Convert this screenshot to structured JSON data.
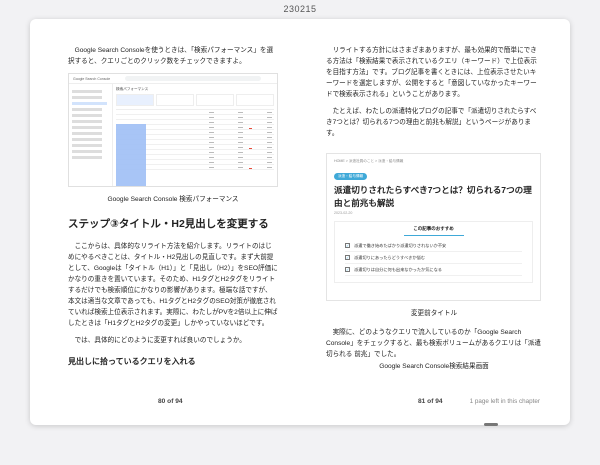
{
  "window": {
    "title": "230215"
  },
  "left_page": {
    "intro": "Google Search Consoleを使うときは、「検索パフォーマンス」を選択すると、クエリごとのクリック数をチェックできますよ。",
    "figure_caption": "Google Search Console 検索パフォーマンス",
    "heading": "ステップ③タイトル・H2見出しを変更する",
    "body": "ここからは、具体的なリライト方法を紹介します。リライトのはじめにやるべきことは、タイトル・H2見出しの見直しです。まず大前提として、Googleは「タイトル（H1）」と「見出し（H2）」をSEO評価にかなりの重きを置いています。そのため、H1タグとH2タグをリライトするだけでも検索順位にかなりの影響があります。極端な話ですが、本文は適当な文章であっても、H1タグとH2タグのSEO対策が徹底されていれば検索上位表示されます。実際に、わたしがPVを2倍以上に伸ばしたときは「H1タグとH2タグの変更」しかやっていないほどです。",
    "followup": "では、具体的にどのように変更すれば良いのでしょうか。",
    "subheading": "見出しに拾っているクエリを入れる",
    "page_number": "80 of 94"
  },
  "search_console": {
    "app": "Google Search Console",
    "panel": "検索パフォーマンス"
  },
  "right_page": {
    "para1": "リライトする方針にはさまざまありますが、最も効果的で簡単にできる方法は「検索結果で表示されているクエリ（キーワード）で上位表示を目指す方法」です。ブログ記事を書くときには、上位表示させたいキーワードを選定しますが、公開をすると「意図していなかったキーワードで検索表示される」ということがあります。",
    "para2": "たとえば、わたしの派遣特化ブログの記事で「派遣切りされたらすべき7つとは？切られる7つの理由と前兆も解説」というページがあります。",
    "figure_caption": "変更前タイトル",
    "para3": "実際に、どのようなクエリで流入しているのか「Google Search Console」をチェックすると、最も検索ボリュームがあるクエリは「派遣 切られる 前兆」でした。",
    "para3_caption": "Google Search Console検索結果画面",
    "page_number": "81 of 94",
    "chapter_left": "1 page left in this chapter"
  },
  "blog_card": {
    "breadcrumb": "HOME > 派遣社員のこと > 派遣・給与情報",
    "tag": "派遣・給与情報",
    "title": "派遣切りされたらすべき7つとは？切られる7つの理由と前兆も解説",
    "date": "2023-02-20",
    "toc_heading": "この記事のおすすめ",
    "toc_items": [
      "派遣で働き始めたばかり派遣切りされないか不安",
      "派遣切りにあったらどうすべきか悩む",
      "派遣切りは自分に何も出来なかったか気になる"
    ]
  },
  "colors": {
    "accent": "#3fa9d8",
    "highlight": "#9fbff5"
  }
}
